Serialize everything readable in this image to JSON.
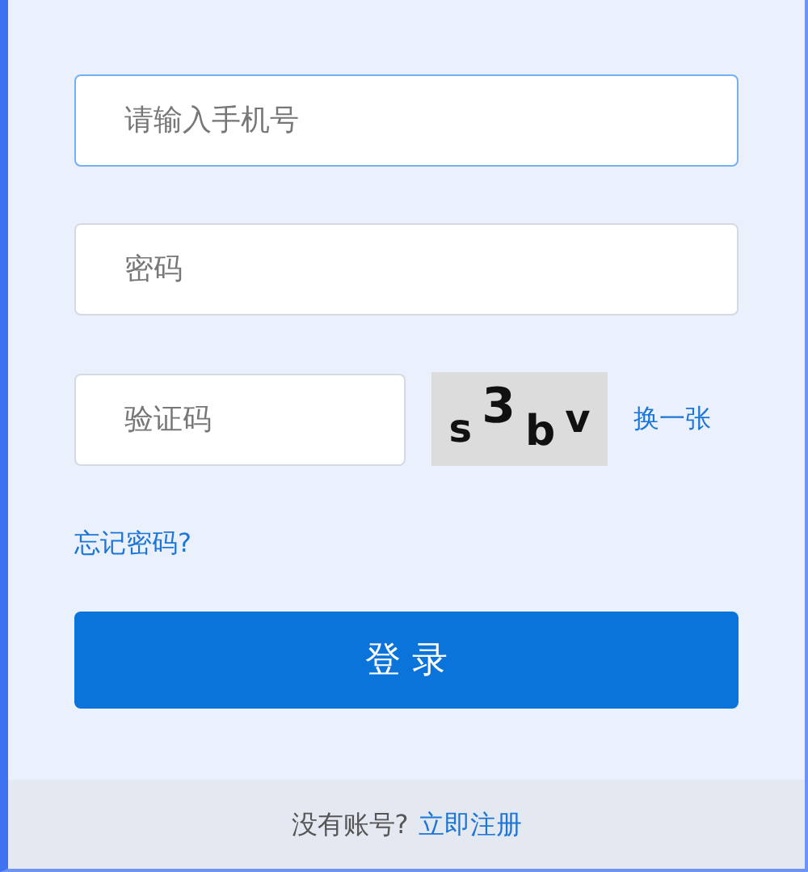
{
  "fields": [
    {
      "placeholder": "请输入手机号",
      "focused": true
    },
    {
      "placeholder": "密码",
      "focused": false
    }
  ],
  "captcha": {
    "placeholder": "验证码",
    "code": [
      "s",
      "3",
      "b",
      "v"
    ],
    "refresh": "换一张"
  },
  "forgot_link": "忘记密码?",
  "login_button": "登 录",
  "footer": {
    "text": "没有账号?",
    "link": "立即注册"
  }
}
